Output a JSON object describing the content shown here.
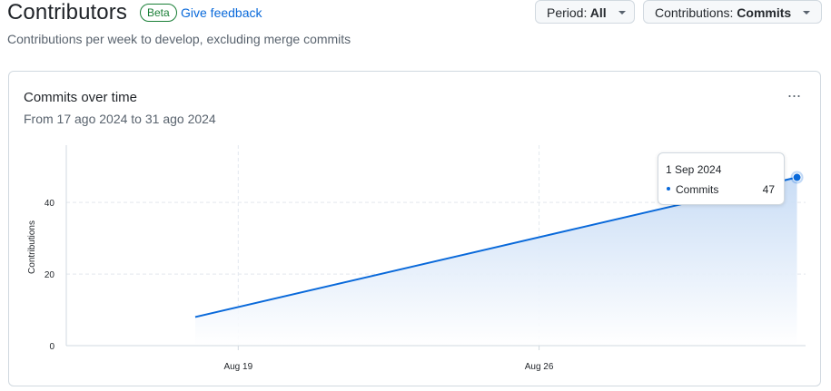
{
  "header": {
    "title": "Contributors",
    "badge": "Beta",
    "feedback_link": "Give feedback",
    "subtitle": "Contributions per week to develop, excluding merge commits"
  },
  "controls": {
    "period_label": "Period:",
    "period_value": "All",
    "contributions_label": "Contributions:",
    "contributions_value": "Commits"
  },
  "card": {
    "title": "Commits over time",
    "range": "From 17 ago 2024 to 31 ago 2024",
    "menu_icon": "kebab-horizontal-icon"
  },
  "tooltip": {
    "date": "1 Sep 2024",
    "series": "Commits",
    "value": "47"
  },
  "colors": {
    "line": "#0969da",
    "area_top": "#c6dbf5",
    "area_bottom": "#ffffff",
    "link": "#0969da",
    "badge": "#1a7f37"
  },
  "chart_data": {
    "type": "area",
    "title": "Commits over time",
    "xlabel": "",
    "ylabel": "Contributions",
    "x": [
      "2024-08-18",
      "2024-09-01"
    ],
    "series": [
      {
        "name": "Commits",
        "values": [
          8,
          47
        ]
      }
    ],
    "xticks": [
      "Aug 19",
      "Aug 26"
    ],
    "xtick_dates": [
      "2024-08-19",
      "2024-08-26"
    ],
    "yticks": [
      0,
      20,
      40
    ],
    "ylim": [
      0,
      56
    ],
    "grid": true,
    "legend": "none"
  }
}
